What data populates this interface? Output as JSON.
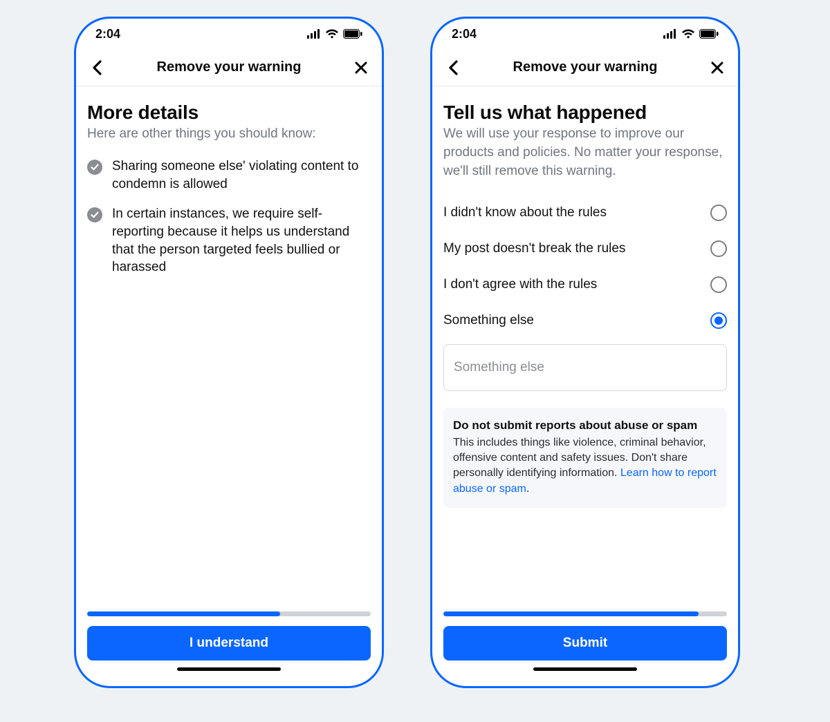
{
  "status": {
    "time": "2:04"
  },
  "nav": {
    "title": "Remove your warning"
  },
  "screens": {
    "left": {
      "heading": "More details",
      "subheading": "Here are other things you should know:",
      "bullets": [
        "Sharing someone else' violating content to condemn is allowed",
        "In certain instances, we require self-reporting because it helps us understand that the person targeted feels bullied or harassed"
      ],
      "progress_percent": 68,
      "cta": "I understand"
    },
    "right": {
      "heading": "Tell us what happened",
      "subheading": "We will use your response to improve our products and policies. No matter your response, we'll still remove this warning.",
      "options": [
        {
          "label": "I didn't know about the rules",
          "selected": false
        },
        {
          "label": "My post doesn't break the rules",
          "selected": false
        },
        {
          "label": "I don't agree with the rules",
          "selected": false
        },
        {
          "label": "Something else",
          "selected": true
        }
      ],
      "textarea_placeholder": "Something else",
      "info": {
        "title": "Do not submit reports about abuse or spam",
        "body_before_link": "This includes things like violence, criminal behavior, offensive content and safety issues. Don't share personally identifying information. ",
        "link": "Learn how to report abuse or spam",
        "body_after_link": "."
      },
      "progress_percent": 90,
      "cta": "Submit"
    }
  }
}
